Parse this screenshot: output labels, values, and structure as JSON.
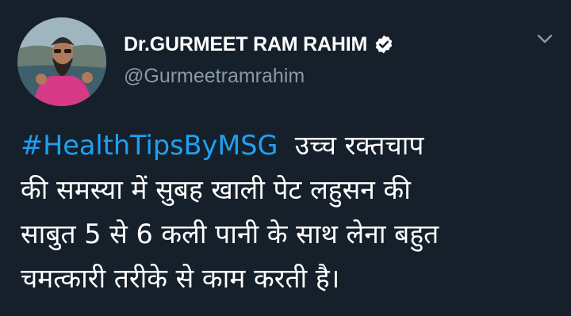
{
  "tweet": {
    "author": {
      "display_name": "Dr.GURMEET RAM RAHIM",
      "handle": "@Gurmeetramrahim",
      "verified_icon": "verified-badge-icon",
      "avatar_icon": "profile-photo"
    },
    "menu_icon": "chevron-down-icon",
    "hashtag": "#HealthTipsByMSG",
    "text_lines": [
      "उच्च रक्तचाप",
      "की समस्या में सुबह खाली पेट लहुसन की",
      "साबुत 5 से 6 कली पानी के साथ लेना बहुत",
      "चमत्कारी तरीके से काम करती है।"
    ]
  },
  "colors": {
    "background": "#15202b",
    "hashtag": "#1da1f2",
    "handle": "#8899a6",
    "text": "#ffffff"
  }
}
